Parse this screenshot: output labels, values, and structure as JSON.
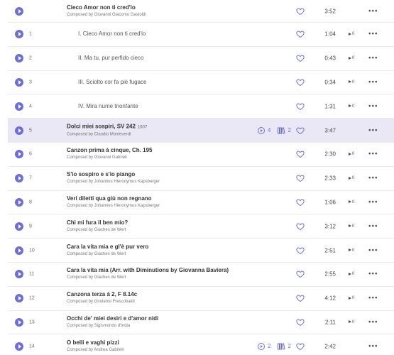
{
  "work": {
    "title": "Cieco Amor non ti cred'io",
    "composer": "Composed by Giovanni Giacomo Gastoldi",
    "duration": "3:52"
  },
  "movements": [
    {
      "num": "1",
      "title": "I. Cieco Amor non ti cred'io",
      "duration": "1:04",
      "downloads": "0"
    },
    {
      "num": "2",
      "title": "II. Ma tu, pur perfido cieco",
      "duration": "0:43",
      "downloads": "0"
    },
    {
      "num": "3",
      "title": "III. Sciolto cor fa piè fugace",
      "duration": "0:34",
      "downloads": "0"
    },
    {
      "num": "4",
      "title": "IV. Mira nume trionfante",
      "duration": "1:31",
      "downloads": "0"
    }
  ],
  "tracks": [
    {
      "num": "5",
      "title": "Dolci miei sospiri, SV 242",
      "year": "1607",
      "composer": "Composed by Claudio Monteverdi",
      "duration": "3:47",
      "badge_plays": "4",
      "badge_albums": "2"
    },
    {
      "num": "6",
      "title": "Canzon prima à cinque, Ch. 195",
      "composer": "Composed by Giovanni Gabrieli",
      "duration": "2:30",
      "downloads": "0"
    },
    {
      "num": "7",
      "title": "S'io sospiro e s'io piango",
      "composer": "Composed by Johannes Hieronymus Kapsberger",
      "duration": "2:33",
      "downloads": "0"
    },
    {
      "num": "8",
      "title": "Veri diletti qua giù non regnano",
      "composer": "Composed by Johannes Hieronymus Kapsberger",
      "duration": "1:06",
      "downloads": "0"
    },
    {
      "num": "9",
      "title": "Chi mi fura il ben mio?",
      "composer": "Composed by Giaches de Wert",
      "duration": "3:12",
      "downloads": "0"
    },
    {
      "num": "10",
      "title": "Cara la vita mia e gl'è pur vero",
      "composer": "Composed by Giaches de Wert",
      "duration": "2:51",
      "downloads": "0"
    },
    {
      "num": "11",
      "title": "Cara la vita mia (Arr. with Diminutions by Giovanna Baviera)",
      "composer": "Composed by Giaches de Wert",
      "duration": "2:55",
      "downloads": "0"
    },
    {
      "num": "12",
      "title": "Canzona terza à 2, F 8.14c",
      "composer": "Composed by Girolamo Frescobaldi",
      "duration": "4:12",
      "downloads": "0"
    },
    {
      "num": "13",
      "title": "Occhi de' miei desiri e d'amor nidi",
      "composer": "Composed by Sigismondo d'India",
      "duration": "2:11",
      "downloads": "0"
    },
    {
      "num": "14",
      "title": "O belli e vaghi pizzi",
      "composer": "Composed by Andrea Gabrieli",
      "duration": "2:42",
      "badge_plays": "2",
      "badge_albums": "2"
    }
  ],
  "icons": {
    "play": "play-icon",
    "heart": "heart-icon",
    "more": "more-icon",
    "download": "download-icon"
  },
  "more_glyph": "•••",
  "colors": {
    "accent": "#6f6fd0",
    "highlight": "#e9e8f4"
  }
}
